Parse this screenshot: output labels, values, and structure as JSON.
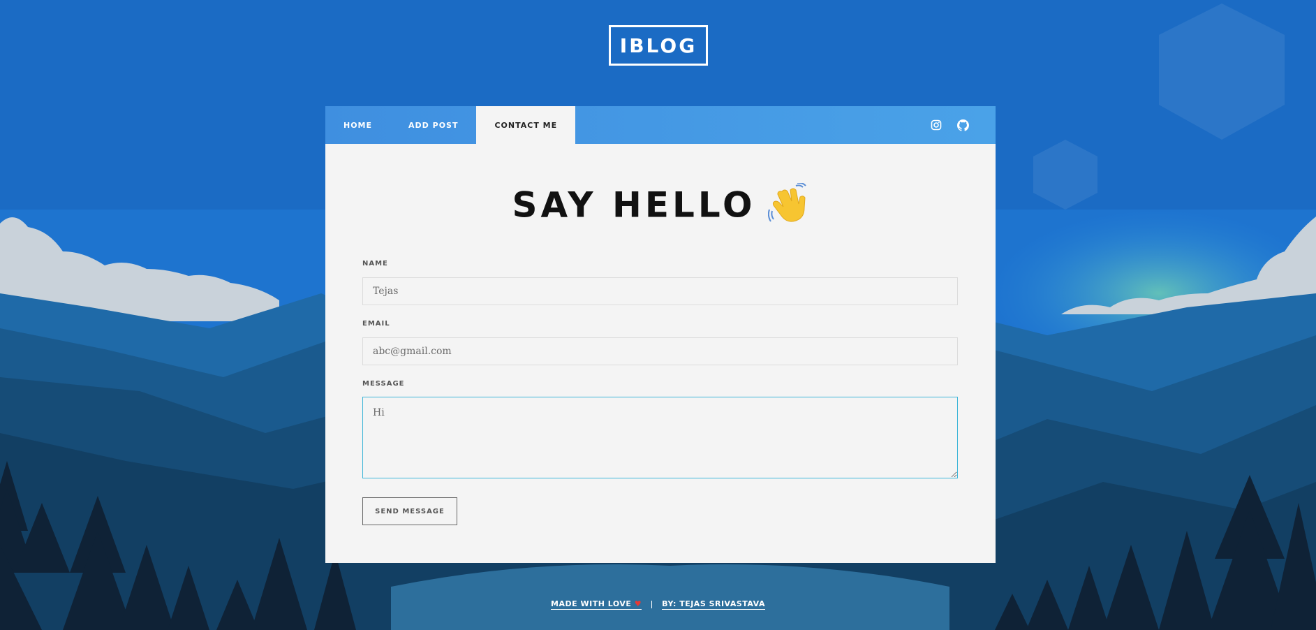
{
  "site": {
    "logo_text": "IBLOG"
  },
  "nav": {
    "items": [
      {
        "label": "HOME"
      },
      {
        "label": "ADD POST"
      },
      {
        "label": "CONTACT ME"
      }
    ],
    "social": [
      "instagram-icon",
      "github-icon"
    ]
  },
  "form": {
    "title": "SAY HELLO",
    "name_label": "NAME",
    "name_value": "Tejas",
    "email_label": "EMAIL",
    "email_value": "abc@gmail.com",
    "message_label": "MESSAGE",
    "message_value": "Hi",
    "submit_label": "SEND MESSAGE"
  },
  "footer": {
    "made_with": "MADE WITH LOVE",
    "heart": "♥",
    "author": "BY: TEJAS SRIVASTAVA"
  },
  "colors": {
    "sky_top": "#1a5fb4",
    "nav_gradient_start": "#3f8fe0",
    "panel_bg": "#f4f4f4",
    "focus_border": "#3fb6d8"
  }
}
